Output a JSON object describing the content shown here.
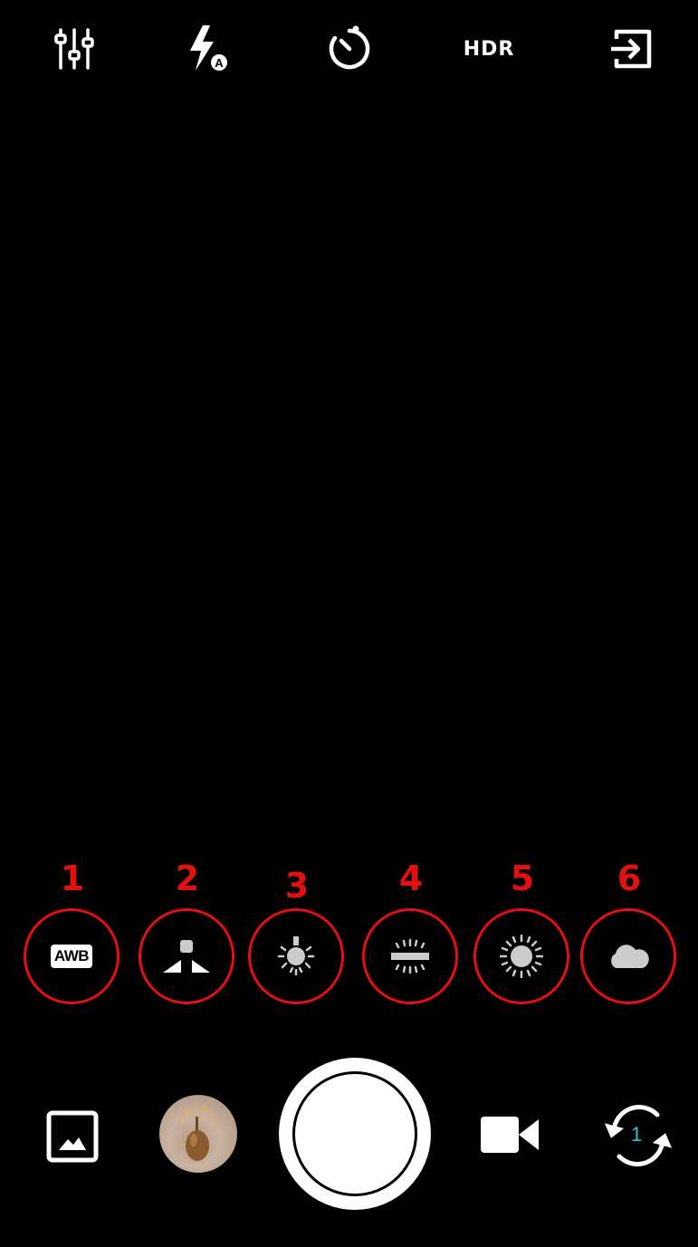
{
  "top_bar": {
    "settings_icon": "sliders-icon",
    "flash_icon": "flash-auto-icon",
    "flash_badge": "A",
    "timer_icon": "timer-icon",
    "hdr_label": "HDR",
    "exit_icon": "exit-icon"
  },
  "white_balance": {
    "items": [
      {
        "number": "1",
        "icon": "awb-icon",
        "label": "AWB"
      },
      {
        "number": "2",
        "icon": "custom-wb-icon"
      },
      {
        "number": "3",
        "icon": "incandescent-bulb-icon"
      },
      {
        "number": "4",
        "icon": "fluorescent-icon"
      },
      {
        "number": "5",
        "icon": "daylight-sun-icon"
      },
      {
        "number": "6",
        "icon": "cloudy-icon"
      }
    ],
    "annotation_color": "#e41010"
  },
  "bottom_bar": {
    "gallery_icon": "gallery-icon",
    "thumbnail": "last-photo-thumbnail",
    "shutter": "shutter-button",
    "video_icon": "video-camera-icon",
    "switch_camera_icon": "switch-camera-icon",
    "camera_index": "1",
    "accent_color": "#2ec4d6"
  }
}
